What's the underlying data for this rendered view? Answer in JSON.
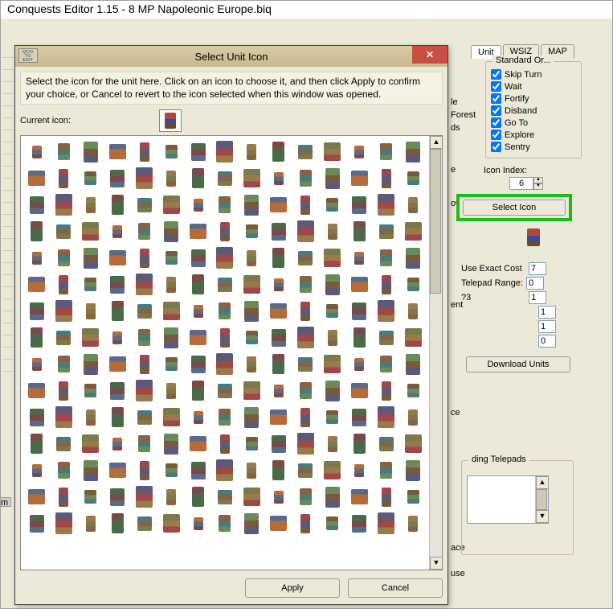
{
  "window": {
    "title": "Conquests Editor 1.15 - 8 MP Napoleonic Europe.biq"
  },
  "tabs": {
    "unit": "Unit",
    "wsiz": "WSIZ",
    "map": "MAP"
  },
  "standard_orders": {
    "title": "Standard Or...",
    "items": [
      {
        "label": "Skip Turn",
        "checked": true
      },
      {
        "label": "Wait",
        "checked": true
      },
      {
        "label": "Fortify",
        "checked": true
      },
      {
        "label": "Disband",
        "checked": true
      },
      {
        "label": "Go To",
        "checked": true
      },
      {
        "label": "Explore",
        "checked": true
      },
      {
        "label": "Sentry",
        "checked": true
      }
    ]
  },
  "icon": {
    "index_label": "Icon Index:",
    "index": "6",
    "select_label": "Select Icon"
  },
  "costs": {
    "use_exact_label": "Use Exact Cost",
    "use_exact": "7",
    "telepad_range_label": "Telepad Range:",
    "telepad_range": "0",
    "q3_label": "?3",
    "v1": "1",
    "v2": "1",
    "v3": "1",
    "v4": "0"
  },
  "download_units_label": "Download Units",
  "telepads": {
    "title": "ding Telepads"
  },
  "peeks": {
    "le": "le",
    "forest": "Forest",
    "ds": "ds",
    "e": "e",
    "ower": "ower",
    "ent": "ent",
    "ce1": "ce",
    "ace": "ace",
    "use": "use"
  },
  "dialog": {
    "title": "Select Unit Icon",
    "sysicon": "QCIV\nTO\nEDIT",
    "desc": "Select the icon for the unit here.  Click on an icon to choose it, and then click Apply to confirm your choice, or Cancel to revert to the icon selected when this window was opened.",
    "current_label": "Current icon:",
    "apply": "Apply",
    "cancel": "Cancel",
    "grid_count": 225,
    "palette": [
      "#b56b3a",
      "#8a6240",
      "#6a8a5a",
      "#5a6a8a",
      "#a04848",
      "#7a5a3a",
      "#4a6a4a",
      "#5a5a7a",
      "#9a7a4a",
      "#7a4a4a",
      "#4a7a7a",
      "#7a7a4a"
    ]
  },
  "bl_row": "m"
}
